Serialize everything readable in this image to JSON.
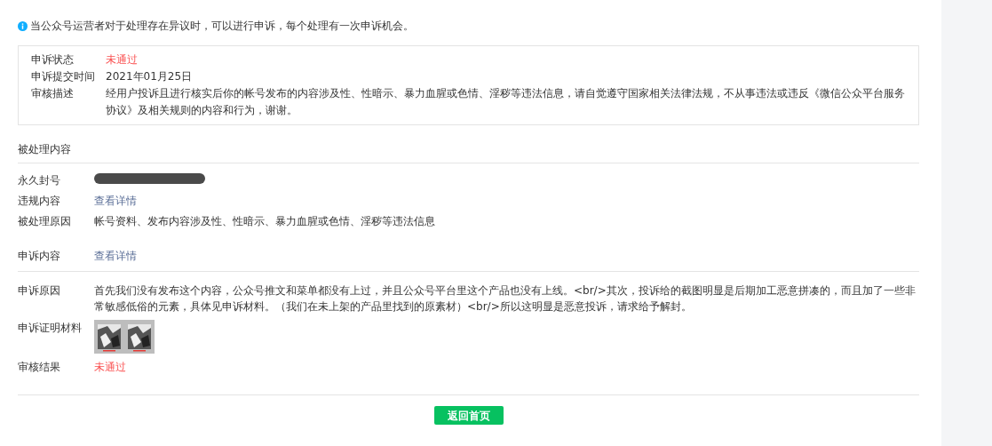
{
  "notice": "当公众号运营者对于处理存在异议时，可以进行申诉，每个处理有一次申诉机会。",
  "summary": [
    {
      "label": "申诉状态",
      "kind": "status",
      "value": "未通过"
    },
    {
      "label": "申诉提交时间",
      "kind": "text",
      "value": "2021年01月25日"
    },
    {
      "label": "审核描述",
      "kind": "text",
      "value": "经用户投诉且进行核实后你的帐号发布的内容涉及性、性暗示、暴力血腥或色情、淫秽等违法信息，请自觉遵守国家相关法律法规，不从事违法或违反《微信公众平台服务协议》及相关规则的内容和行为，谢谢。"
    }
  ],
  "handled": {
    "title": "被处理内容",
    "rows": [
      {
        "label": "永久封号",
        "kind": "redacted"
      },
      {
        "label": "违规内容",
        "kind": "link",
        "value": "查看详情"
      },
      {
        "label": "被处理原因",
        "kind": "text",
        "value": "帐号资料、发布内容涉及性、性暗示、暴力血腥或色情、淫秽等违法信息"
      }
    ]
  },
  "appeal": {
    "header": {
      "label": "申诉内容",
      "kind": "link",
      "value": "查看详情"
    },
    "rows": [
      {
        "label": "申诉原因",
        "kind": "text",
        "value": "首先我们没有发布这个内容，公众号推文和菜单都没有上过，并且公众号平台里这个产品也没有上线。<br/>其次，投诉给的截图明显是后期加工恶意拼凑的，而且加了一些非常敏感低俗的元素，具体见申诉材料。（我们在未上架的产品里找到的原素材）<br/>所以这明显是恶意投诉，请求给予解封。"
      },
      {
        "label": "申诉证明材料",
        "kind": "images"
      },
      {
        "label": "审核结果",
        "kind": "status",
        "value": "未通过"
      }
    ]
  },
  "button": "返回首页"
}
